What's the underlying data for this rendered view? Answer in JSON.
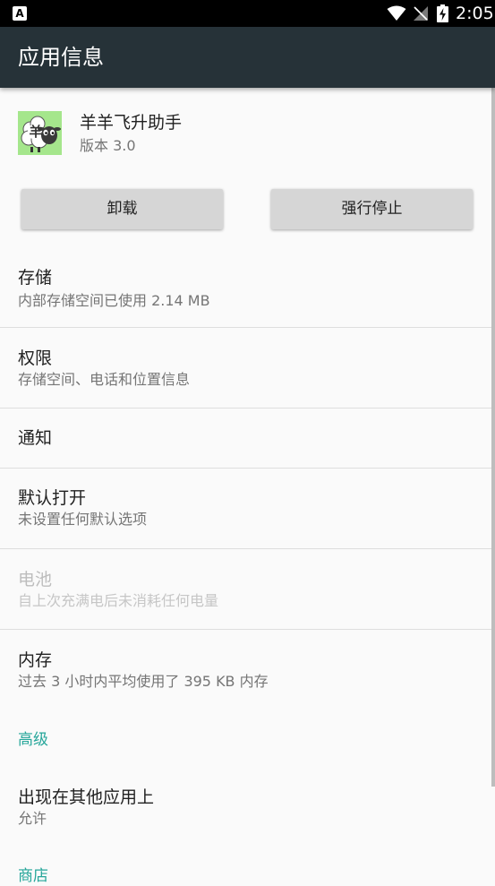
{
  "status_bar": {
    "time": "2:05",
    "notification_icon": "A",
    "icons": [
      "wifi-icon",
      "no-signal-icon",
      "battery-charging-icon"
    ]
  },
  "app_bar": {
    "title": "应用信息"
  },
  "app": {
    "name": "羊羊飞升助手",
    "version": "版本 3.0",
    "icon_glyph": "羊"
  },
  "buttons": {
    "uninstall": "卸载",
    "force_stop": "强行停止"
  },
  "prefs": {
    "storage": {
      "title": "存储",
      "summary": "内部存储空间已使用 2.14 MB"
    },
    "permissions": {
      "title": "权限",
      "summary": "存储空间、电话和位置信息"
    },
    "notifications": {
      "title": "通知"
    },
    "open_default": {
      "title": "默认打开",
      "summary": "未设置任何默认选项"
    },
    "battery": {
      "title": "电池",
      "summary": "自上次充满电后未消耗任何电量"
    },
    "memory": {
      "title": "内存",
      "summary": "过去 3 小时内平均使用了 395 KB 内存"
    },
    "draw_over": {
      "title": "出现在其他应用上",
      "summary": "允许"
    }
  },
  "sections": {
    "advanced": "高级",
    "store": "商店"
  },
  "colors": {
    "app_bar": "#263238",
    "accent": "#26a69a",
    "button": "#d6d6d6",
    "background": "#fafafa"
  }
}
